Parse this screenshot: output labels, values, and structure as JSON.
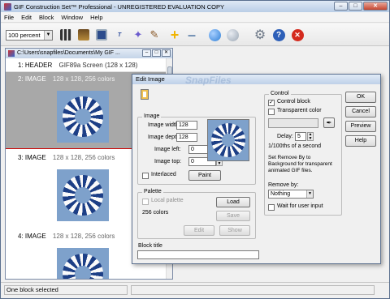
{
  "window": {
    "title": "GIF Construction Set™ Professional - UNREGISTERED EVALUATION COPY"
  },
  "menu": [
    "File",
    "Edit",
    "Block",
    "Window",
    "Help"
  ],
  "toolbar": {
    "zoom_value": "100 percent",
    "icons": [
      "film-icon",
      "open-folder-icon",
      "save-icon",
      "text-icon",
      "wizard-icon",
      "brush-icon",
      "add-icon",
      "remove-icon",
      "play-icon",
      "stop-icon",
      "settings-icon",
      "help-icon",
      "exit-icon"
    ],
    "colors": {
      "add": "#f0b400",
      "play": "#2f7fd6",
      "stop": "#9aa6b4",
      "help": "#2d5fb8",
      "exit": "#d42a1e"
    }
  },
  "document": {
    "title": "C:\\Users\\snapfiles\\Documents\\My GIF ...",
    "blocks": [
      {
        "id": "1: HEADER",
        "info": "GIF89a Screen (128 x 128)"
      },
      {
        "id": "2: IMAGE",
        "info": "128 x 128, 256 colors"
      },
      {
        "id": "3: IMAGE",
        "info": "128 x 128, 256 colors"
      },
      {
        "id": "4: IMAGE",
        "info": "128 x 128, 256 colors"
      }
    ]
  },
  "status": {
    "text": "One block selected"
  },
  "dialog": {
    "title": "Edit Image",
    "image_group": {
      "legend": "Image",
      "width_label": "Image width:",
      "width_value": "128",
      "depth_label": "Image depth:",
      "depth_value": "128",
      "left_label": "Image left:",
      "left_value": "0",
      "top_label": "Image top:",
      "top_value": "0",
      "interlaced_label": "Interlaced",
      "paint_label": "Paint"
    },
    "palette_group": {
      "legend": "Palette",
      "local_label": "Local palette",
      "colors_label": "256 colors",
      "load_label": "Load",
      "save_label": "Save",
      "edit_label": "Edit",
      "show_label": "Show"
    },
    "block_title_label": "Block title",
    "control_group": {
      "legend": "Control",
      "control_block_label": "Control block",
      "transparent_label": "Transparent color",
      "delay_label": "Delay:",
      "delay_value": "5",
      "delay_unit": "1/100ths of a second",
      "note": "Set Remove By to Background for transparent animated GIF files.",
      "remove_by_label": "Remove by:",
      "remove_by_value": "Nothing",
      "wait_label": "Wait for user input"
    },
    "buttons": {
      "ok": "OK",
      "cancel": "Cancel",
      "preview": "Preview",
      "help": "Help"
    },
    "watermark": "SnapFiles"
  }
}
